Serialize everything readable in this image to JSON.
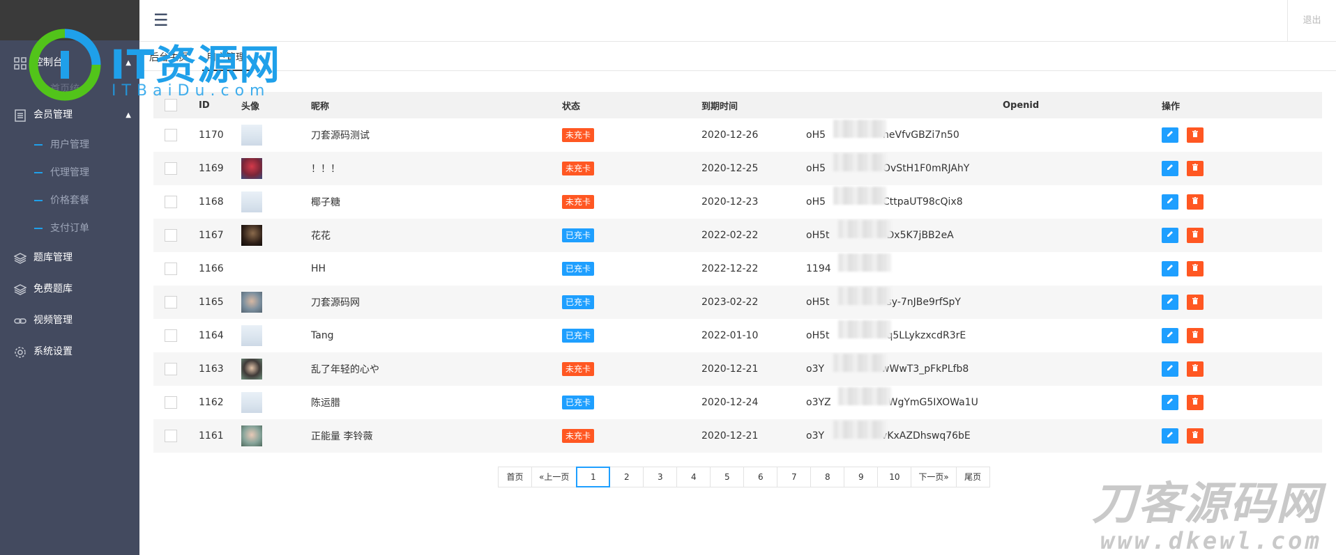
{
  "sidebar": {
    "menu": [
      {
        "label": "控制台",
        "icon": "grid-icon",
        "expanded": true
      },
      {
        "label": "会员管理",
        "icon": "document-list-icon",
        "expanded": true
      },
      {
        "label": "题库管理",
        "icon": "layers-icon"
      },
      {
        "label": "免费题库",
        "icon": "layers-icon"
      },
      {
        "label": "视频管理",
        "icon": "link-icon"
      },
      {
        "label": "系统设置",
        "icon": "gear-icon"
      }
    ],
    "console_sub": [
      "首页统"
    ],
    "member_sub": [
      "用户管理",
      "代理管理",
      "价格套餐",
      "支付订单"
    ]
  },
  "header": {
    "menu_icon": "hamburger-icon",
    "logout_label": "退出"
  },
  "tabs": [
    "后台主页",
    "用户管理"
  ],
  "logo": {
    "text": "IT资源网",
    "sub": "ITBaiDu.com"
  },
  "table": {
    "columns": [
      "ID",
      "头像",
      "昵称",
      "状态",
      "到期时间",
      "Openid",
      "操作"
    ],
    "rows": [
      {
        "id": "1170",
        "avatar": "default",
        "nickname": "刀套源码测试",
        "status": "未充卡",
        "status_color": "#ff5722",
        "expire": "2020-12-26",
        "openid_prefix": "oH5",
        "openid_suffix": "heVfvGBZi7n50"
      },
      {
        "id": "1169",
        "avatar": "red",
        "nickname": "！！！",
        "status": "未充卡",
        "status_color": "#ff5722",
        "expire": "2020-12-25",
        "openid_prefix": "oH5",
        "openid_suffix": "OvStH1F0mRJAhY"
      },
      {
        "id": "1168",
        "avatar": "default",
        "nickname": "椰子糖",
        "status": "未充卡",
        "status_color": "#ff5722",
        "expire": "2020-12-23",
        "openid_prefix": "oH5",
        "openid_suffix": "CttpaUT98cQix8"
      },
      {
        "id": "1167",
        "avatar": "dark",
        "nickname": "花花",
        "status": "已充卡",
        "status_color": "#1e9fff",
        "expire": "2022-02-22",
        "openid_prefix": "oH5t",
        "openid_suffix": "Dx5K7jBB2eA"
      },
      {
        "id": "1166",
        "avatar": "none",
        "nickname": "HH",
        "status": "已充卡",
        "status_color": "#1e9fff",
        "expire": "2022-12-22",
        "openid_prefix": "1194",
        "openid_suffix": ""
      },
      {
        "id": "1165",
        "avatar": "person",
        "nickname": "刀套源码网",
        "status": "已充卡",
        "status_color": "#1e9fff",
        "expire": "2023-02-22",
        "openid_prefix": "oH5t",
        "openid_suffix": "sy-7nJBe9rfSpY"
      },
      {
        "id": "1164",
        "avatar": "default",
        "nickname": "Tang",
        "status": "已充卡",
        "status_color": "#1e9fff",
        "expire": "2022-01-10",
        "openid_prefix": "oH5t",
        "openid_suffix": "q5LLykzxcdR3rE"
      },
      {
        "id": "1163",
        "avatar": "boy",
        "nickname": "乱了年轻的心や",
        "status": "未充卡",
        "status_color": "#ff5722",
        "expire": "2020-12-21",
        "openid_prefix": "o3Y",
        "openid_suffix": "wWwT3_pFkPLfb8"
      },
      {
        "id": "1162",
        "avatar": "default",
        "nickname": "陈运腊",
        "status": "已充卡",
        "status_color": "#1e9fff",
        "expire": "2020-12-24",
        "openid_prefix": "o3YZ",
        "openid_suffix": "WgYmG5IXOWa1U"
      },
      {
        "id": "1161",
        "avatar": "girl",
        "nickname": "正能量 李铃薇",
        "status": "未充卡",
        "status_color": "#ff5722",
        "expire": "2020-12-21",
        "openid_prefix": "o3Y",
        "openid_suffix": "vKxAZDhswq76bE"
      }
    ]
  },
  "pagination": {
    "first": "首页",
    "prev": "«上一页",
    "pages": [
      "1",
      "2",
      "3",
      "4",
      "5",
      "6",
      "7",
      "8",
      "9",
      "10"
    ],
    "current": "1",
    "next": "下一页»",
    "last": "尾页"
  },
  "watermark": {
    "cn": "刀客源码网",
    "en": "www.dkewl.com"
  },
  "colors": {
    "sidebar_bg": "#434a5f",
    "accent_blue": "#1e9fff",
    "accent_orange": "#ff5722"
  }
}
